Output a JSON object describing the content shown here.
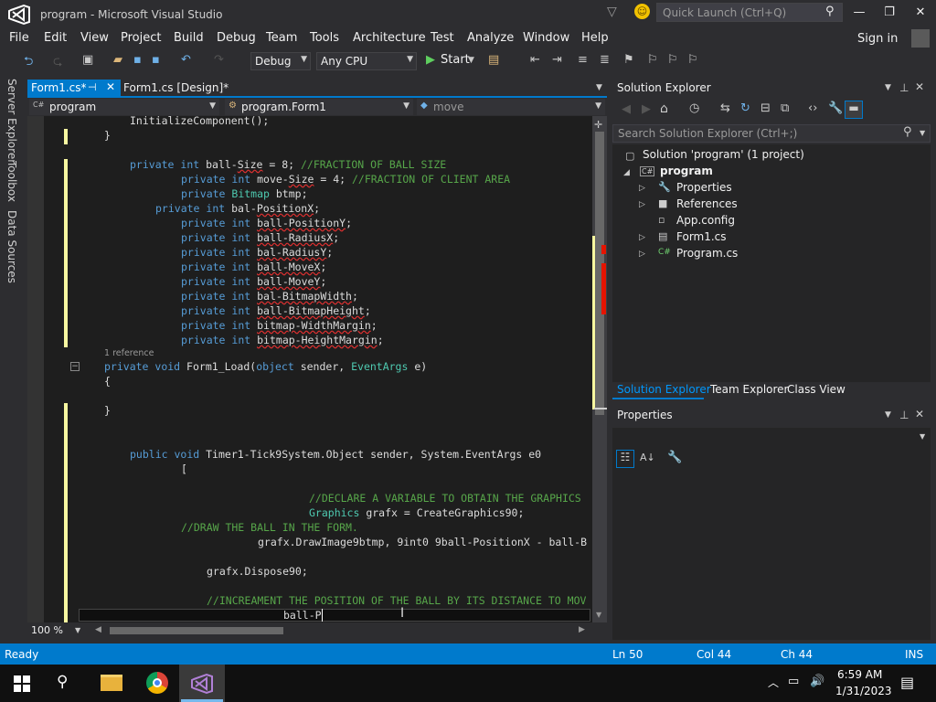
{
  "window": {
    "title": "program - Microsoft Visual Studio",
    "quick_launch_placeholder": "Quick Launch (Ctrl+Q)"
  },
  "menu": [
    "File",
    "Edit",
    "View",
    "Project",
    "Build",
    "Debug",
    "Team",
    "Tools",
    "Architecture",
    "Test",
    "Analyze",
    "Window",
    "Help"
  ],
  "signin": "Sign in",
  "toolbar": {
    "config": "Debug",
    "platform": "Any CPU",
    "start_label": "Start"
  },
  "side_tabs": [
    "Server Explorer",
    "Toolbox",
    "Data Sources"
  ],
  "editor_tabs": {
    "active": "Form1.cs*",
    "design": "Form1.cs [Design]*"
  },
  "nav": {
    "project": "program",
    "type": "program.Form1",
    "member": "move"
  },
  "code": {
    "l_init": "InitializeComponent();",
    "l_brace1": "}",
    "ref_hint": "1 reference",
    "form1_load": "Form1_Load",
    "timer_sig": "Timer1-Tick9System.Object sender, System.EventArgs e0",
    "bracket": "[",
    "cmt_declare": "//DECLARE A VARIABLE TO OBTAIN THE GRAPHICS",
    "graphics_line": " grafx = CreateGraphics90;",
    "cmt_draw": "//DRAW THE BALL IN THE FORM.",
    "drawimage": "grafx.DrawImage9btmp, 9int0 9ball-PositionX - ball-B",
    "dispose": "grafx.Dispose90;",
    "cmt_incr": "//INCREAMENT THE POSITION OF THE BALL BY ITS DISTANCE TO MOV",
    "current": "ball-P"
  },
  "editor_zoom": "100 %",
  "solution_explorer": {
    "title": "Solution Explorer",
    "search_placeholder": "Search Solution Explorer (Ctrl+;)",
    "solution": "Solution 'program' (1 project)",
    "project": "program",
    "items": [
      "Properties",
      "References",
      "App.config",
      "Form1.cs",
      "Program.cs"
    ],
    "bottom_tabs": [
      "Solution Explorer",
      "Team Explorer",
      "Class View"
    ]
  },
  "properties": {
    "title": "Properties"
  },
  "status": {
    "state": "Ready",
    "ln": "Ln 50",
    "col": "Col 44",
    "ch": "Ch 44",
    "mode": "INS"
  },
  "taskbar": {
    "time": "6:59 AM",
    "date": "1/31/2023"
  },
  "colors": {
    "accent": "#007acc",
    "keyword": "#569cd6",
    "type": "#4ec9b0",
    "comment": "#57a64a"
  }
}
